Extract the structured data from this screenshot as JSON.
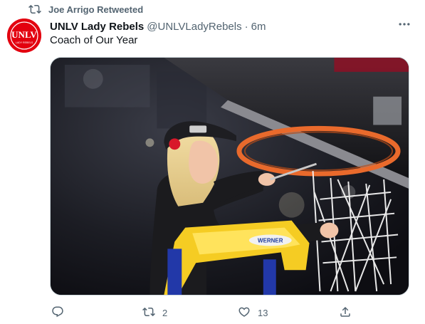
{
  "retweet_banner": {
    "text": "Joe Arrigo Retweeted"
  },
  "author": {
    "name": "UNLV Lady Rebels",
    "handle": "@UNLVLadyRebels",
    "separator": "·",
    "time": "6m",
    "avatar_text": "UNLV",
    "avatar_subtext": "LADY REBELS"
  },
  "tweet": {
    "text": "Coach of Our Year"
  },
  "media": {
    "ladder_label": "WERNER"
  },
  "actions": {
    "reply_count": "",
    "retweet_count": "2",
    "like_count": "13"
  },
  "colors": {
    "secondary_text": "#536471",
    "primary_text": "#0f1419",
    "unlv_red": "#e3000f",
    "border": "#cfd9de"
  },
  "icons": [
    "retweet-icon",
    "more-icon",
    "reply-icon",
    "like-icon",
    "share-icon"
  ]
}
